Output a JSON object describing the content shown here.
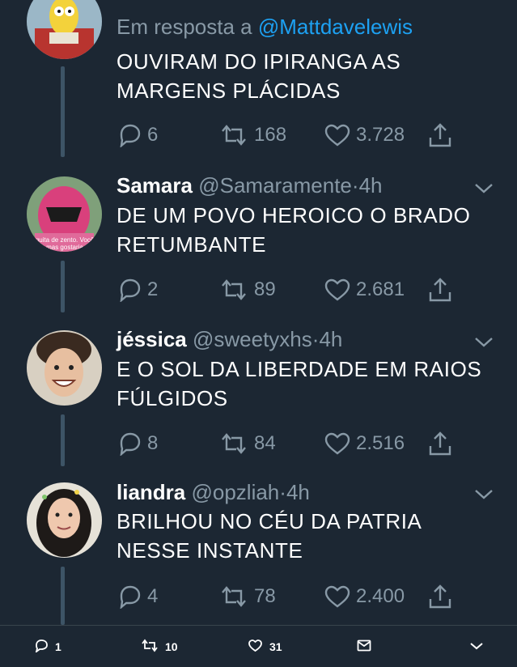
{
  "tweets": [
    {
      "name": "",
      "handle": "",
      "reply_label": "Em resposta a",
      "reply_mention": "@Mattdavelewis",
      "text": "OUVIRAM DO IPIRANGA AS MARGENS PLÁCIDAS",
      "replies": "6",
      "retweets": "168",
      "likes": "3.728"
    },
    {
      "name": "Samara",
      "handle": "@Samaramente",
      "dot": "·",
      "time": "4h",
      "text": "DE UM POVO HEROICO O BRADO RETUMBANTE",
      "replies": "2",
      "retweets": "89",
      "likes": "2.681",
      "avatar_caption": "quita de zento. Você mas gostaria"
    },
    {
      "name": "jéssica",
      "handle": "@sweetyxhs",
      "dot": "·",
      "time": "4h",
      "text": "E O SOL DA LIBERDADE EM RAIOS FÚLGIDOS",
      "replies": "8",
      "retweets": "84",
      "likes": "2.516"
    },
    {
      "name": "liandra",
      "handle": "@opzliah",
      "dot": "·",
      "time": "4h",
      "text": "BRILHOU NO CÉU DA PATRIA NESSE INSTANTE",
      "replies": "4",
      "retweets": "78",
      "likes": "2.400"
    }
  ],
  "bottom_bar": {
    "replies": "1",
    "retweets": "10",
    "likes": "31"
  },
  "colors": {
    "background": "#1c2733",
    "muted": "#8899a6",
    "link": "#1da1f2",
    "thread_line": "#3d5466"
  },
  "icons": [
    "reply-icon",
    "retweet-icon",
    "like-icon",
    "share-icon",
    "chevron-down-icon",
    "mail-icon"
  ]
}
